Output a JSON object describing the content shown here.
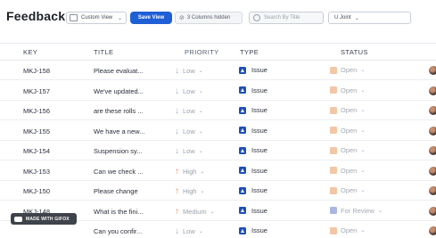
{
  "page": {
    "title": "Feedback"
  },
  "toolbar": {
    "view_select": "Custom View",
    "save_view": "Save View",
    "hidden_columns": "3 Columns hidden",
    "search_placeholder": "Search By Title",
    "filter_select": "U Joint"
  },
  "columns": [
    "KEY",
    "TITLE",
    "PRIORITY",
    "TYPE",
    "STATUS"
  ],
  "colors": {
    "accent": "#1f5fd6",
    "type_icon": "#1d4fb8",
    "priority_up": "#f08a5d",
    "priority_down": "#9ab2c8",
    "status_open": "#f3c6a6",
    "status_review": "#a9b7e0"
  },
  "rows": [
    {
      "key": "MKJ-158",
      "title": "Please evaluat...",
      "priority": "Low",
      "priority_dir": "down",
      "type": "Issue",
      "status": "Open",
      "status_color": "#f3c6a6"
    },
    {
      "key": "MKJ-157",
      "title": "We've updated...",
      "priority": "Low",
      "priority_dir": "down",
      "type": "Issue",
      "status": "Open",
      "status_color": "#f3c6a6"
    },
    {
      "key": "MKJ-156",
      "title": "are these rolls ...",
      "priority": "Low",
      "priority_dir": "down",
      "type": "Issue",
      "status": "Open",
      "status_color": "#f3c6a6"
    },
    {
      "key": "MKJ-155",
      "title": "We have a new...",
      "priority": "Low",
      "priority_dir": "down",
      "type": "Issue",
      "status": "Open",
      "status_color": "#f3c6a6"
    },
    {
      "key": "MKJ-154",
      "title": "Suspension sy...",
      "priority": "Low",
      "priority_dir": "down",
      "type": "Issue",
      "status": "Open",
      "status_color": "#f3c6a6"
    },
    {
      "key": "MKJ-153",
      "title": "Can we check ...",
      "priority": "High",
      "priority_dir": "up",
      "type": "Issue",
      "status": "Open",
      "status_color": "#f3c6a6"
    },
    {
      "key": "MKJ-150",
      "title": "Please change",
      "priority": "High",
      "priority_dir": "up",
      "type": "Issue",
      "status": "Open",
      "status_color": "#f3c6a6"
    },
    {
      "key": "MKJ-148",
      "title": "What is the fini...",
      "priority": "Medium",
      "priority_dir": "up",
      "type": "Issue",
      "status": "For Review",
      "status_color": "#a9b7e0"
    },
    {
      "key": "",
      "title": "Can you confir...",
      "priority": "Low",
      "priority_dir": "down",
      "type": "Issue",
      "status": "Open",
      "status_color": "#f3c6a6"
    }
  ],
  "watermark": "MADE WITH GIFOX"
}
